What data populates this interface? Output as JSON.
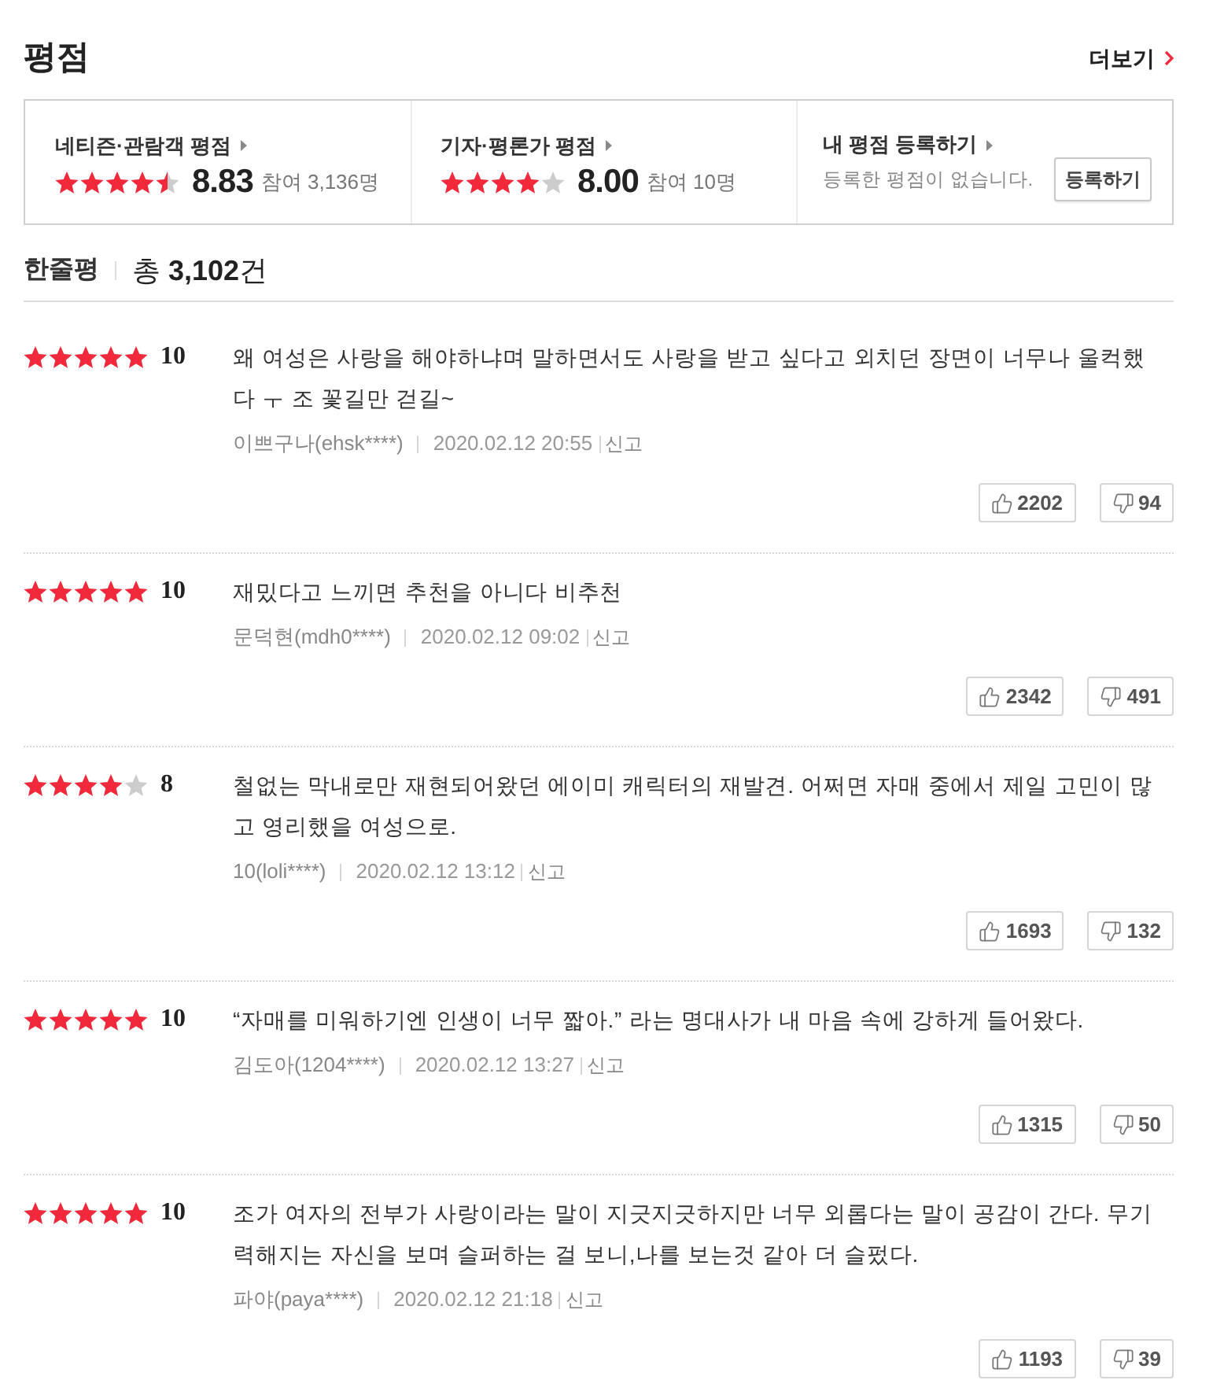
{
  "header": {
    "title": "평점",
    "more_link": "더보기"
  },
  "rating_summary": [
    {
      "kind": "rating",
      "title": "네티즌·관람객 평점",
      "stars": 4.5,
      "score": "8.83",
      "participants": "참여 3,136명"
    },
    {
      "kind": "rating",
      "title": "기자·평론가 평점",
      "stars": 4,
      "score": "8.00",
      "participants": "참여 10명"
    },
    {
      "kind": "register",
      "title": "내 평점 등록하기",
      "message": "등록한 평점이 없습니다.",
      "button": "등록하기"
    }
  ],
  "reviews_header": {
    "title": "한줄평",
    "total": "총 **3,102**건"
  },
  "reviews": [
    {
      "stars": 5,
      "score": "10",
      "text": "왜 여성은 사랑을 해야하냐며 말하면서도 사랑을 받고 싶다고 외치던 장면이 너무나 울컥했다 ㅜ 조 꽃길만 걷길~",
      "author": "이쁘구나(ehsk****)",
      "date": "2020.02.12 20:55",
      "report": "신고",
      "likes": "2202",
      "dislikes": "94"
    },
    {
      "stars": 5,
      "score": "10",
      "text": "재밌다고 느끼면 추천을 아니다 비추천",
      "author": "문덕현(mdh0****)",
      "date": "2020.02.12 09:02",
      "report": "신고",
      "likes": "2342",
      "dislikes": "491"
    },
    {
      "stars": 4,
      "score": "8",
      "text": "철없는 막내로만 재현되어왔던 에이미 캐릭터의 재발견. 어쩌면 자매 중에서 제일 고민이 많고 영리했을 여성으로.",
      "author": "10(loli****)",
      "date": "2020.02.12 13:12",
      "report": "신고",
      "likes": "1693",
      "dislikes": "132"
    },
    {
      "stars": 5,
      "score": "10",
      "text": "“자매를 미워하기엔 인생이 너무 짧아.” 라는 명대사가 내 마음 속에 강하게 들어왔다.",
      "author": "김도아(1204****)",
      "date": "2020.02.12 13:27",
      "report": "신고",
      "likes": "1315",
      "dislikes": "50"
    },
    {
      "stars": 5,
      "score": "10",
      "text": "조가 여자의 전부가 사랑이라는 말이 지긋지긋하지만 너무 외롭다는 말이 공감이 간다. 무기력해지는 자신을 보며 슬퍼하는 걸 보니,나를 보는것 같아 더 슬펐다.",
      "author": "파야(paya****)",
      "date": "2020.02.12 21:18",
      "report": "신고",
      "likes": "1193",
      "dislikes": "39"
    }
  ]
}
